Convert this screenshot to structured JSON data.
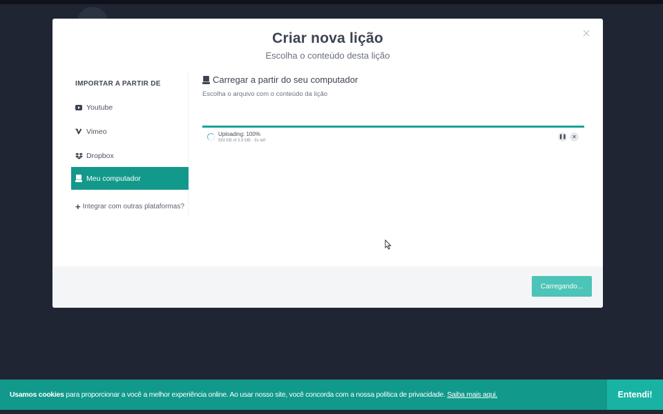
{
  "modal": {
    "title": "Criar nova lição",
    "subtitle": "Escolha o conteúdo desta lição",
    "close_icon": "close-icon"
  },
  "sidebar": {
    "heading": "IMPORTAR A PARTIR DE",
    "items": [
      {
        "label": "Youtube",
        "icon": "youtube-icon",
        "active": false
      },
      {
        "label": "Vimeo",
        "icon": "vimeo-icon",
        "active": false
      },
      {
        "label": "Dropbox",
        "icon": "dropbox-icon",
        "active": false
      },
      {
        "label": "Meu computador",
        "icon": "hard-drive-icon",
        "active": true
      }
    ],
    "integrate_label": "Integrar com outras plataformas?"
  },
  "main": {
    "title": "Carregar a partir do seu computador",
    "subtitle": "Escolha o arquivo com o conteúdo da lição",
    "upload": {
      "status": "Uploading: 100%",
      "detail": "993 KB of 3.9 MB · 8s left",
      "progress_percent": 100
    }
  },
  "footer": {
    "primary_button": "Carregando..."
  },
  "cookie": {
    "bold": "Usamos cookies",
    "text": " para proporcionar a você a melhor experiência online. Ao usar nosso site, você concorda com a nossa política de privacidade. ",
    "link": "Saiba mais aqui.",
    "button": "Entendi!"
  },
  "colors": {
    "accent": "#13998b",
    "button_disabled": "#4cc4b8",
    "backdrop": "#1f2533"
  }
}
